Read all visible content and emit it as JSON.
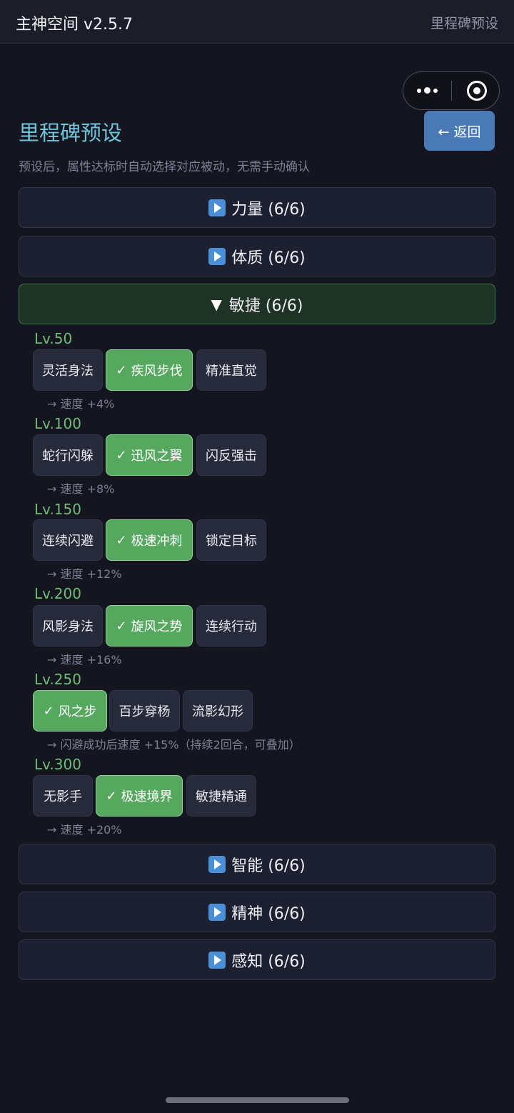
{
  "header": {
    "app_title": "主神空间 v2.5.7",
    "right_label": "里程碑预设"
  },
  "page": {
    "title": "里程碑预设",
    "back_label": "← 返回",
    "subtitle": "预设后，属性达标时自动选择对应被动，无需手动确认"
  },
  "categories": [
    {
      "label": "力量 (6/6)",
      "expanded": false
    },
    {
      "label": "体质 (6/6)",
      "expanded": false
    },
    {
      "label": "敏捷 (6/6)",
      "expanded": true
    },
    {
      "label": "智能 (6/6)",
      "expanded": false
    },
    {
      "label": "精神 (6/6)",
      "expanded": false
    },
    {
      "label": "感知 (6/6)",
      "expanded": false
    }
  ],
  "milestones": [
    {
      "level": "Lv.50",
      "options": [
        "灵活身法",
        "疾风步伐",
        "精准直觉"
      ],
      "selected": 1,
      "effect": "→ 速度 +4%"
    },
    {
      "level": "Lv.100",
      "options": [
        "蛇行闪躲",
        "迅风之翼",
        "闪反强击"
      ],
      "selected": 1,
      "effect": "→ 速度 +8%"
    },
    {
      "level": "Lv.150",
      "options": [
        "连续闪避",
        "极速冲刺",
        "锁定目标"
      ],
      "selected": 1,
      "effect": "→ 速度 +12%"
    },
    {
      "level": "Lv.200",
      "options": [
        "风影身法",
        "旋风之势",
        "连续行动"
      ],
      "selected": 1,
      "effect": "→ 速度 +16%"
    },
    {
      "level": "Lv.250",
      "options": [
        "风之步",
        "百步穿杨",
        "流影幻形"
      ],
      "selected": 0,
      "effect": "→ 闪避成功后速度 +15%（持续2回合，可叠加）"
    },
    {
      "level": "Lv.300",
      "options": [
        "无影手",
        "极速境界",
        "敏捷精通"
      ],
      "selected": 1,
      "effect": "→ 速度 +20%"
    }
  ],
  "icons": {
    "collapsed": "play-icon",
    "expanded": "triangle-down-icon",
    "selected": "check-icon"
  },
  "colors": {
    "accent": "#6ec5dc",
    "selected": "#55a85e",
    "level": "#6bbf73",
    "back_button": "#4a7ab5"
  }
}
